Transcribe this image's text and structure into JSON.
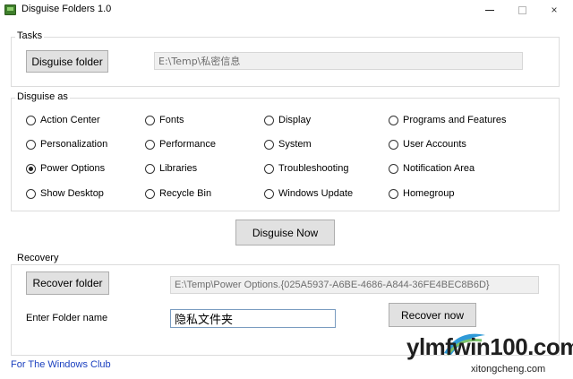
{
  "window": {
    "title": "Disguise Folders 1.0",
    "icon": "folder-app-icon",
    "controls": {
      "minimize": "minimize-icon",
      "maximize": "maximize-icon",
      "close": "×"
    }
  },
  "tasks": {
    "legend": "Tasks",
    "disguise_button": "Disguise folder",
    "path_value": "E:\\Temp\\私密信息"
  },
  "disguise_as": {
    "legend": "Disguise as",
    "selected": "Power Options",
    "options": [
      "Action Center",
      "Fonts",
      "Display",
      "Programs and Features",
      "Personalization",
      "Performance",
      "System",
      "User Accounts",
      "Power Options",
      "Libraries",
      "Troubleshooting",
      "Notification Area",
      "Show Desktop",
      "Recycle Bin",
      "Windows Update",
      "Homegroup"
    ]
  },
  "disguise_now_button": "Disguise Now",
  "recovery": {
    "legend": "Recovery",
    "recover_folder_button": "Recover folder",
    "path_value": "E:\\Temp\\Power Options.{025A5937-A6BE-4686-A844-36FE4BEC8B6D}",
    "folder_name_label": "Enter Folder name",
    "folder_name_value": "隐私文件夹",
    "recover_now_button": "Recover now"
  },
  "footer": {
    "link": "For The Windows Club"
  },
  "watermark": {
    "main": "ylmfwin100.com",
    "sub": "xitongcheng.com"
  },
  "colors": {
    "link": "#1a3fbf",
    "button_bg": "#e1e1e1",
    "edit_border": "#7a9cc0"
  }
}
